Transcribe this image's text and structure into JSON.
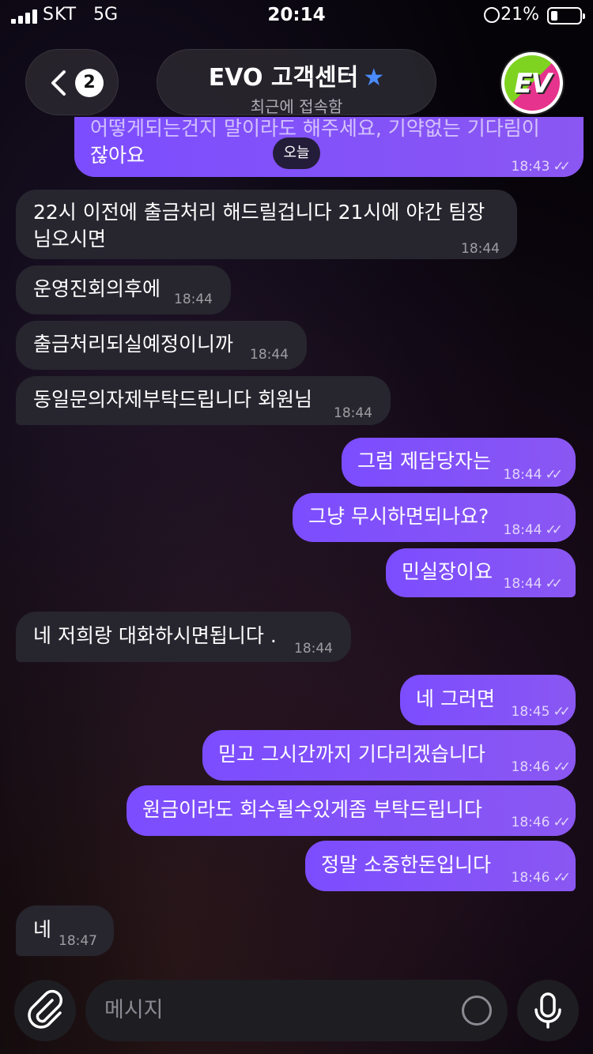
{
  "status": {
    "carrier": "SKT",
    "network": "5G",
    "time": "20:14",
    "battery": "21%"
  },
  "header": {
    "back_count": "2",
    "title": "EVO 고객센터",
    "subtitle": "최근에 접속함",
    "avatar_text": "EV"
  },
  "date_chip": "오늘",
  "messages": [
    {
      "dir": "out",
      "text_line1": "어떻게되는건지 말이라도 해주세요, 기약없는 기다림이",
      "text_line2": "잖아요",
      "time": "18:43"
    },
    {
      "dir": "in",
      "text_line1": "22시 이전에 출금처리 해드릴겁니다 21시에 야간 팀장",
      "text_line2": "님오시면",
      "time": "18:44"
    },
    {
      "dir": "in",
      "text": "운영진회의후에",
      "time": "18:44"
    },
    {
      "dir": "in",
      "text": "출금처리되실예정이니까",
      "time": "18:44"
    },
    {
      "dir": "in",
      "text": "동일문의자제부탁드립니다 회원님",
      "time": "18:44"
    },
    {
      "dir": "out",
      "text": "그럼 제담당자는",
      "time": "18:44"
    },
    {
      "dir": "out",
      "text": "그냥 무시하면되나요?",
      "time": "18:44"
    },
    {
      "dir": "out",
      "text": "민실장이요",
      "time": "18:44"
    },
    {
      "dir": "in",
      "text": "네 저희랑 대화하시면됩니다 .",
      "time": "18:44"
    },
    {
      "dir": "out",
      "text": "네 그러면",
      "time": "18:45"
    },
    {
      "dir": "out",
      "text": "믿고 그시간까지 기다리겠습니다",
      "time": "18:46"
    },
    {
      "dir": "out",
      "text": "원금이라도 회수될수있게좀 부탁드립니다",
      "time": "18:46"
    },
    {
      "dir": "out",
      "text": "정말 소중한돈입니다",
      "time": "18:46"
    },
    {
      "dir": "in",
      "text": "네",
      "time": "18:47"
    }
  ],
  "composer": {
    "placeholder": "메시지"
  },
  "colors": {
    "outgoing": "#7c4dff",
    "incoming": "#27252e",
    "star": "#4a8cff"
  }
}
